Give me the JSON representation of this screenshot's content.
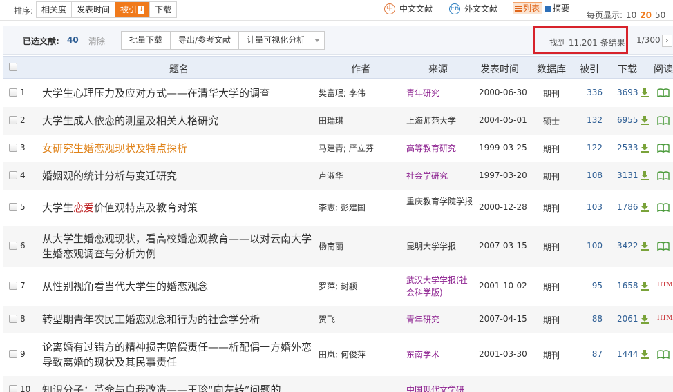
{
  "sortbar": {
    "label": "排序:",
    "options": [
      "相关度",
      "发表时间",
      "被引",
      "下载"
    ],
    "active_index": 2,
    "active_arrow": "↓",
    "lang_cn": "中文文献",
    "lang_cn_icon": "中",
    "lang_en": "外文文献",
    "lang_en_icon": "En",
    "view_list": "列表",
    "view_abstract": "摘要",
    "perpage_label": "每页显示:",
    "perpage_options": [
      "10",
      "20",
      "50"
    ],
    "perpage_selected": "20"
  },
  "selbar": {
    "label": "已选文献:",
    "count": "40",
    "clear": "清除",
    "buttons": [
      "批量下载",
      "导出/参考文献",
      "计量可视化分析"
    ],
    "found": "找到 11,201 条结果",
    "page": "1/300",
    "next": "›"
  },
  "table": {
    "headers": [
      "题名",
      "作者",
      "来源",
      "发表时间",
      "数据库",
      "被引",
      "下载",
      "阅读"
    ],
    "rows": [
      {
        "num": "1",
        "title": "大学生心理压力及应对方式——在清华大学的调查",
        "author": "樊富珉; 李伟",
        "source": "青年研究",
        "date": "2000-06-30",
        "db": "期刊",
        "cite": "336",
        "dl": "3693",
        "read": "book"
      },
      {
        "num": "2",
        "title": "大学生成人依恋的测量及相关人格研究",
        "author": "田瑞琪",
        "source": "上海师范大学",
        "date": "2004-05-01",
        "db": "硕士",
        "cite": "132",
        "dl": "6955",
        "read": "book"
      },
      {
        "num": "3",
        "title": "女研究生婚恋观现状及特点探析",
        "author": "马建青; 严立芬",
        "source": "高等教育研究",
        "date": "1999-03-25",
        "db": "期刊",
        "cite": "122",
        "dl": "2533",
        "read": "book"
      },
      {
        "num": "4",
        "title": "婚姻观的统计分析与变迁研究",
        "author": "卢淑华",
        "source": "社会学研究",
        "date": "1997-03-20",
        "db": "期刊",
        "cite": "108",
        "dl": "3131",
        "read": "book"
      },
      {
        "num": "5",
        "title_pre": "大学生",
        "title_hl": "恋爱",
        "title_post": "价值观特点及教育对策",
        "author": "李志; 彭建国",
        "source": "重庆教育学院学报",
        "date": "2000-12-28",
        "db": "期刊",
        "cite": "103",
        "dl": "1786",
        "read": "book"
      },
      {
        "num": "6",
        "title": "从大学生婚恋观现状，看高校婚恋观教育——以对云南大学生婚恋观调查与分析为例",
        "author": "杨南丽",
        "source": "昆明大学学报",
        "date": "2007-03-15",
        "db": "期刊",
        "cite": "100",
        "dl": "3422",
        "read": "book"
      },
      {
        "num": "7",
        "title": "从性别视角看当代大学生的婚恋观念",
        "author": "罗萍; 封颖",
        "source": "武汉大学学报(社会科学版)",
        "date": "2001-10-02",
        "db": "期刊",
        "cite": "95",
        "dl": "1658",
        "read": "HTML"
      },
      {
        "num": "8",
        "title": "转型期青年农民工婚恋观念和行为的社会学分析",
        "author": "贺飞",
        "source": "青年研究",
        "date": "2007-04-15",
        "db": "期刊",
        "cite": "88",
        "dl": "2061",
        "read": "HTML"
      },
      {
        "num": "9",
        "title": "论离婚有过错方的精神损害赔偿责任——析配偶一方婚外恋导致离婚的现状及其民事责任",
        "author": "田岚; 何俊萍",
        "source": "东南学术",
        "date": "2001-03-30",
        "db": "期刊",
        "cite": "87",
        "dl": "1444",
        "read": "book"
      },
      {
        "num": "10",
        "title": "知识分子：革命与自我改造——王珍“向左转”问题的",
        "author": "",
        "source": "中国现代文学研",
        "date": "",
        "db": "",
        "cite": "",
        "dl": "",
        "read": ""
      }
    ]
  },
  "colors": {
    "accent_orange": "#f07a1c",
    "source_purple": "#8b1e8e",
    "link_blue": "#2e5e94",
    "highlight_red": "#d7222b",
    "html_red": "#c8282c"
  }
}
